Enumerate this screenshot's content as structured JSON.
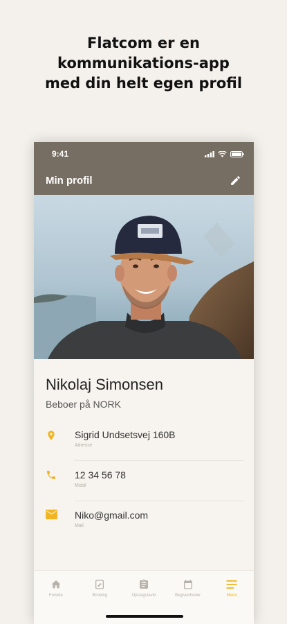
{
  "headline": {
    "line1": "Flatcom er en",
    "line2": "kommunikations-app",
    "line3": "med din helt egen profil"
  },
  "status_bar": {
    "time": "9:41"
  },
  "app_bar": {
    "title": "Min profil",
    "edit_icon": "pencil-icon"
  },
  "profile": {
    "name": "Nikolaj Simonsen",
    "role": "Beboer på NORK",
    "details": [
      {
        "icon": "location-pin-icon",
        "value": "Sigrid Undsetsvej 160B",
        "label": "Adresse"
      },
      {
        "icon": "phone-icon",
        "value": "12 34 56 78",
        "label": "Mobil"
      },
      {
        "icon": "mail-icon",
        "value": "Niko@gmail.com",
        "label": "Mail"
      }
    ]
  },
  "tabs": [
    {
      "icon": "home-icon",
      "label": "Forside"
    },
    {
      "icon": "booking-icon",
      "label": "Booking"
    },
    {
      "icon": "clipboard-icon",
      "label": "Opslagstavle"
    },
    {
      "icon": "calendar-icon",
      "label": "Begivenheder"
    },
    {
      "icon": "menu-icon",
      "label": "Menu",
      "active": true
    }
  ],
  "colors": {
    "header": "#776e63",
    "accent": "#f2b41f",
    "background": "#f4f0eb"
  }
}
